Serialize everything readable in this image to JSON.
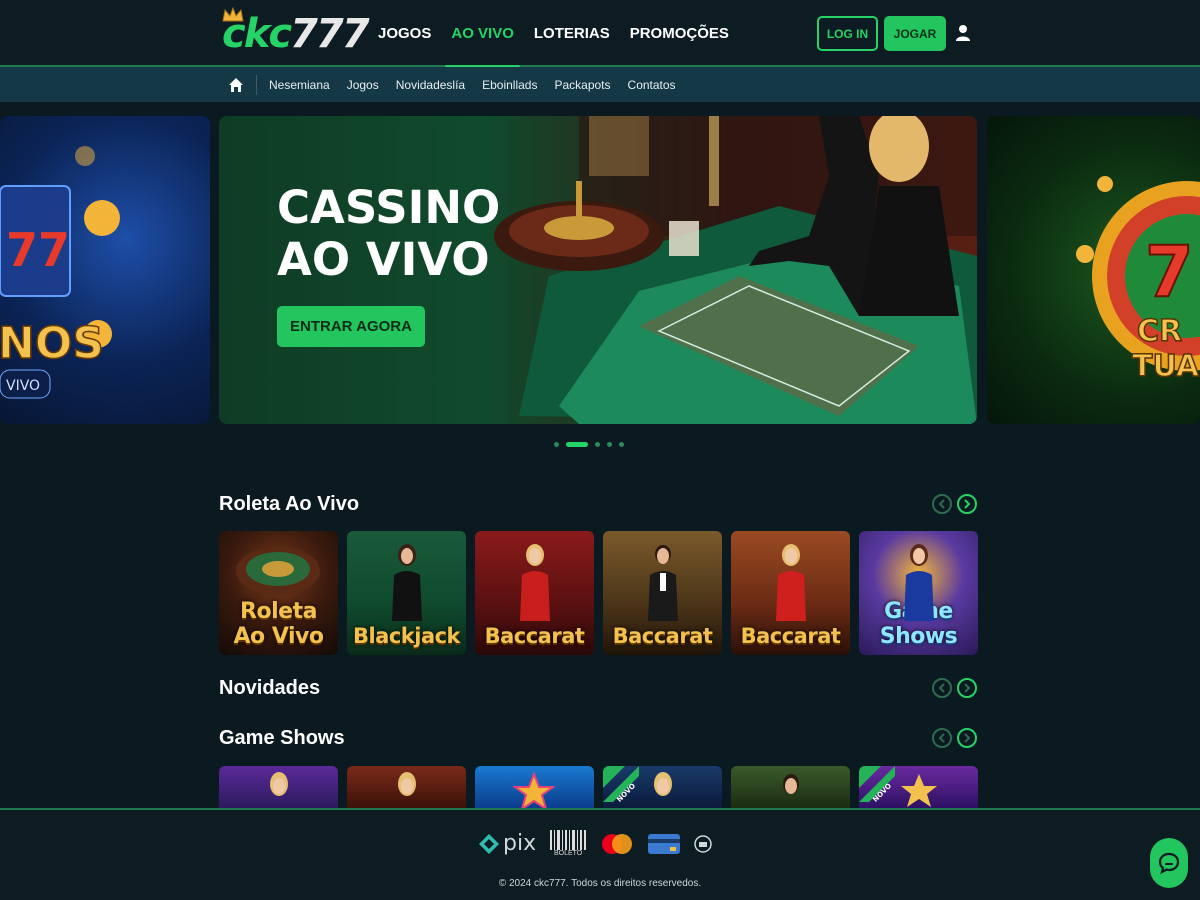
{
  "header": {
    "logo_main": "ckc",
    "logo_num": "777",
    "nav": [
      {
        "label": "JOGOS",
        "active": false
      },
      {
        "label": "AO VIVO",
        "active": true
      },
      {
        "label": "LOTERIAS",
        "active": false
      },
      {
        "label": "PROMOÇÕES",
        "active": false
      }
    ],
    "login_label": "LOG IN",
    "play_label": "JOGAR",
    "user_icon": "user-icon"
  },
  "subnav": {
    "home_icon": "home-icon",
    "items": [
      "Nesemiana",
      "Jogos",
      "Novidadeslía",
      "Eboinllads",
      "Packapots",
      "Contatos"
    ]
  },
  "hero": {
    "title_line1": "CASSINO",
    "title_line2": "AO VIVO",
    "cta": "ENTRAR AGORA",
    "left_slide_text": "NOS",
    "left_slide_sub": "VIVO",
    "right_slide_text": "CR",
    "right_slide_sub": "TUA",
    "dots_total": 5,
    "dots_active_index": 1
  },
  "sections": {
    "roleta": {
      "title": "Roleta Ao Vivo",
      "cards": [
        {
          "line1": "Roleta",
          "line2": "Ao Vivo"
        },
        {
          "line1": "Blackjack",
          "line2": ""
        },
        {
          "line1": "Baccarat",
          "line2": ""
        },
        {
          "line1": "Baccarat",
          "line2": ""
        },
        {
          "line1": "Baccarat",
          "line2": ""
        },
        {
          "line1": "Game",
          "line2": "Shows"
        }
      ]
    },
    "novidades": {
      "title": "Novidades"
    },
    "gameshows": {
      "title": "Game Shows",
      "badge_text": "NOVO"
    }
  },
  "footer": {
    "pix_label": "pix",
    "boleto_label": "BOLETO",
    "copyright": "© 2024 ckc777. Todos os direitos reservedos."
  },
  "colors": {
    "accent": "#25d366",
    "background": "#0a1a20",
    "subnav": "#143845"
  }
}
